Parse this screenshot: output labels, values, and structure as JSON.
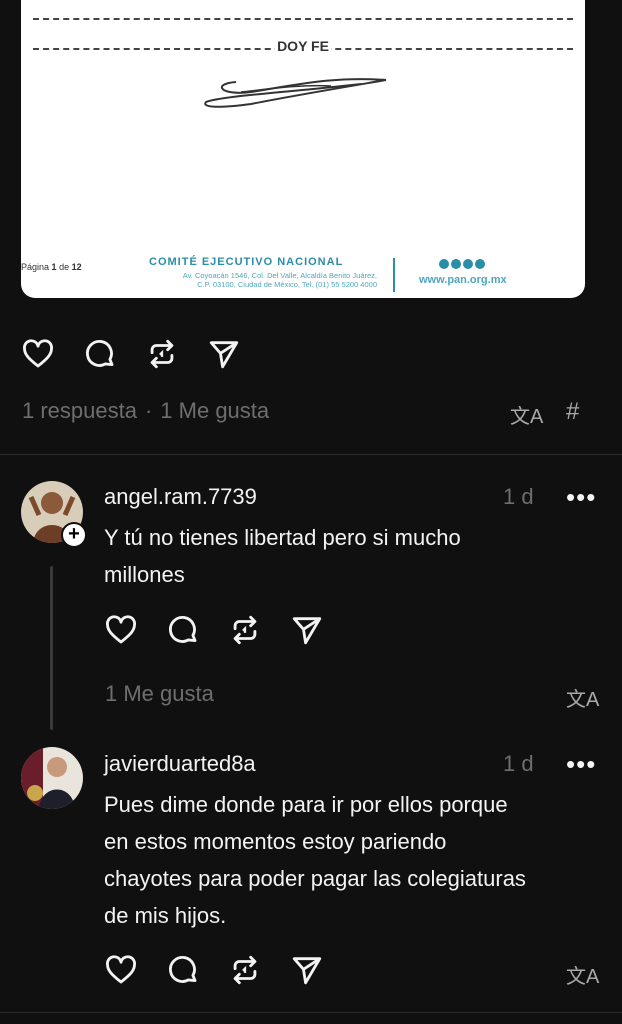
{
  "document": {
    "heading": "DOY FE",
    "page_prefix": "Página",
    "page_current": "1",
    "page_of": "de",
    "page_total": "12",
    "org_name": "COMITÉ EJECUTIVO NACIONAL",
    "address_line1": "Av. Coyoacán 1546, Col. Del Valle, Alcaldía Benito Juárez,",
    "address_line2": "C.P. 03100, Ciudad de México, Tel. (01) 55 5200 4000",
    "website": "www.pan.org.mx"
  },
  "post": {
    "replies": "1 respuesta",
    "separator": "·",
    "likes": "1 Me gusta",
    "translate_icon": "translate-icon",
    "hashtag_icon": "#"
  },
  "replies": [
    {
      "username": "angel.ram.7739",
      "time": "1 d",
      "more": "•••",
      "text_line1": "Y tú no tienes libertad pero si mucho",
      "text_line2": "millones",
      "likes": "1 Me gusta",
      "badge": "+"
    },
    {
      "username": "javierduarted8a",
      "time": "1 d",
      "more": "•••",
      "text_line1": "Pues dime donde para ir por ellos porque",
      "text_line2": "en estos momentos estoy pariendo",
      "text_line3": "chayotes para poder pagar las colegiaturas",
      "text_line4": "de mis hijos."
    }
  ],
  "icons": {
    "like": "heart-icon",
    "reply": "comment-icon",
    "repost": "repost-icon",
    "share": "send-icon",
    "translate": "文A"
  },
  "colors": {
    "background": "#101010",
    "text": "#f3f3f3",
    "muted": "#6e6e6e",
    "brand": "#2a8ea8"
  }
}
